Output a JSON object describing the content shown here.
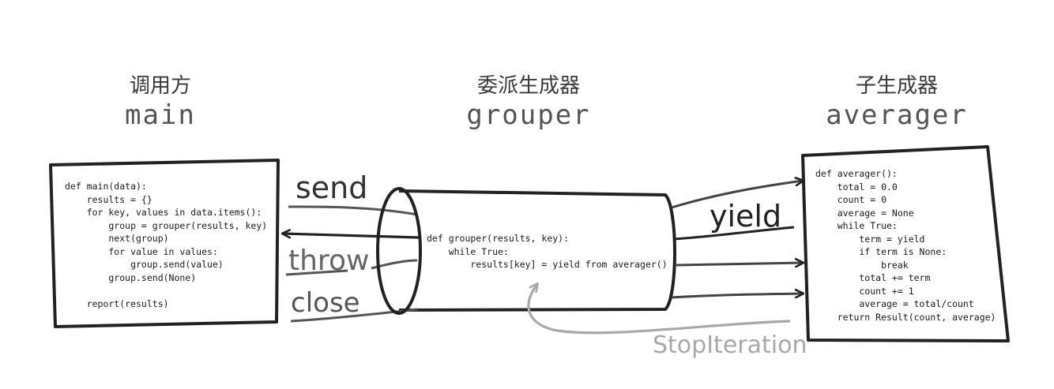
{
  "headings": {
    "caller": {
      "cn": "调用方",
      "en": "main"
    },
    "delegating": {
      "cn": "委派生成器",
      "en": "grouper"
    },
    "subgen": {
      "cn": "子生成器",
      "en": "averager"
    }
  },
  "code": {
    "main": "def main(data):\n    results = {}\n    for key, values in data.items():\n        group = grouper(results, key)\n        next(group)\n        for value in values:\n            group.send(value)\n        group.send(None)\n\n    report(results)",
    "grouper": "def grouper(results, key):\n    while True:\n        results[key] = yield from averager()",
    "averager": "def averager():\n    total = 0.0\n    count = 0\n    average = None\n    while True:\n        term = yield\n        if term is None:\n            break\n        total += term\n        count += 1\n        average = total/count\n    return Result(count, average)"
  },
  "labels": {
    "send": "send",
    "throw": "throw",
    "close": "close",
    "yield": "yield",
    "stop": "StopIteration"
  },
  "colors": {
    "ink": "#222222",
    "gray_arrow": "#a8a8a8",
    "muted": "#666666"
  }
}
